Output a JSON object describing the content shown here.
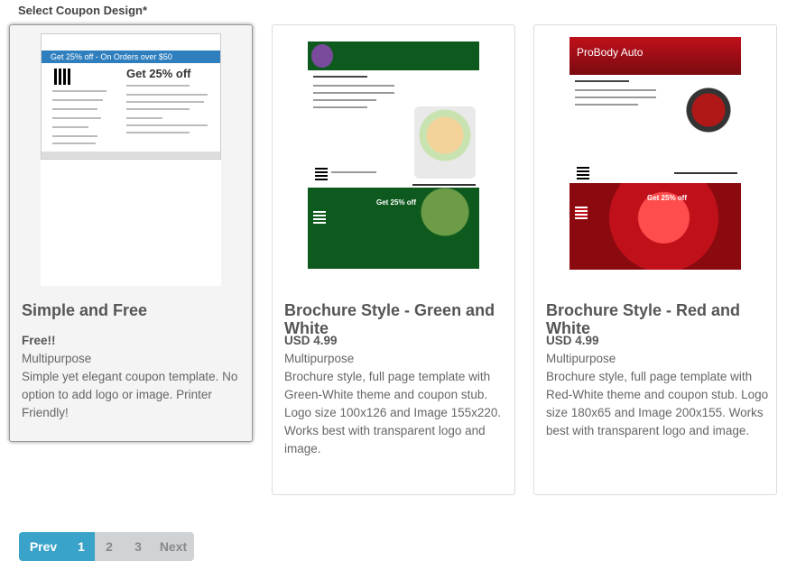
{
  "heading": "Select Coupon Design*",
  "cards": [
    {
      "title": "Simple and Free",
      "price": "Free!!",
      "category": "Multipurpose",
      "description": "Simple yet elegant coupon template. No option to add logo or image. Printer Friendly!",
      "thumb": {
        "banner": "Get 25% off - On Orders over $50",
        "headline": "Get 25% off"
      }
    },
    {
      "title": "Brochure Style - Green and White",
      "price": "USD 4.99",
      "category": "Multipurpose",
      "description": "Brochure style, full page template with Green-White theme and coupon stub. Logo size 100x126 and Image 155x220. Works best with transparent logo and image.",
      "thumb": {
        "offer": "Get 25% off",
        "color": "#0e5a1e"
      }
    },
    {
      "title": "Brochure Style - Red and White",
      "price": "USD 4.99",
      "category": "Multipurpose",
      "description": "Brochure style, full page template with Red-White theme and coupon stub. Logo size 180x65 and Image 200x155. Works best with transparent logo and image.",
      "thumb": {
        "brand": "ProBody Auto",
        "offer": "Get 25% off",
        "color": "#c0101a"
      }
    }
  ],
  "pagination": {
    "prev": "Prev",
    "pages": [
      "1",
      "2",
      "3"
    ],
    "current": "1",
    "next": "Next"
  },
  "colors": {
    "accent": "#3aa3c9",
    "inactive": "#cfd3d6"
  }
}
